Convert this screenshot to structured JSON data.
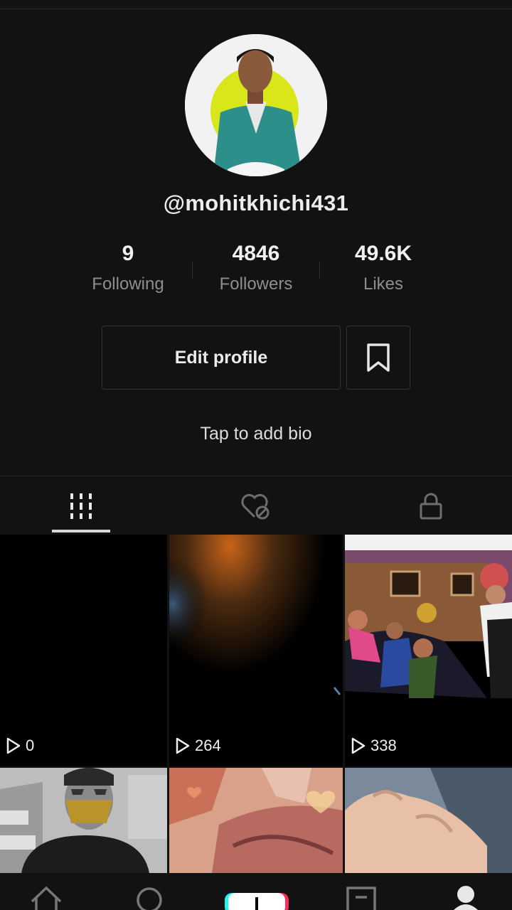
{
  "profile": {
    "username": "@mohitkhichi431",
    "bio_placeholder": "Tap to add bio"
  },
  "stats": {
    "following": {
      "value": "9",
      "label": "Following"
    },
    "followers": {
      "value": "4846",
      "label": "Followers"
    },
    "likes": {
      "value": "49.6K",
      "label": "Likes"
    }
  },
  "actions": {
    "edit_profile_label": "Edit profile",
    "bookmark_icon": "bookmark-icon"
  },
  "tabs": [
    {
      "icon": "grid-icon",
      "active": true
    },
    {
      "icon": "liked-hidden-icon",
      "active": false
    },
    {
      "icon": "lock-icon",
      "active": false
    }
  ],
  "videos": [
    {
      "views": "0"
    },
    {
      "views": "264"
    },
    {
      "views": "338"
    },
    {
      "views": ""
    },
    {
      "views": ""
    },
    {
      "views": ""
    }
  ],
  "bottom_nav": [
    {
      "icon": "home-icon"
    },
    {
      "icon": "search-icon"
    },
    {
      "icon": "create-plus-icon"
    },
    {
      "icon": "inbox-icon"
    },
    {
      "icon": "profile-icon"
    }
  ],
  "colors": {
    "background": "#121212",
    "accent_cyan": "#25f4ee",
    "accent_red": "#fe2c55",
    "text_secondary": "#8e8e8e"
  }
}
